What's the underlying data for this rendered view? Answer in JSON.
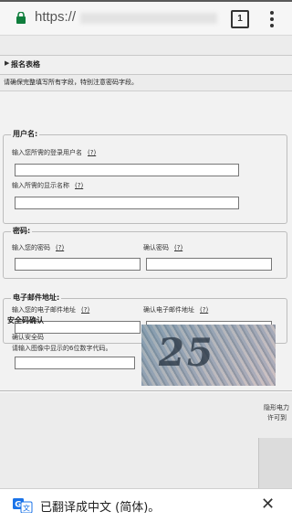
{
  "browser": {
    "url_prefix": "https://",
    "tab_count": "1"
  },
  "form": {
    "section_title": "报名表格",
    "instruction": "请确保完整填写所有字段，特别注意密码字段。",
    "help_mark": "(?)",
    "username": {
      "legend": "用户名:",
      "login_label": "输入您所需的登录用户名",
      "display_label": "输入所需的显示名称"
    },
    "password": {
      "legend": "密码:",
      "enter_label": "输入您的密码",
      "confirm_label": "确认密码"
    },
    "email": {
      "legend": "电子邮件地址:",
      "enter_label": "输入您的电子邮件地址",
      "confirm_label": "确认电子邮件地址"
    },
    "captcha": {
      "legend": "安全码确认",
      "label_line1": "确认安全码",
      "label_line2": "请输入图像中显示的6位数字代码。",
      "image_text": "25"
    }
  },
  "footer": {
    "line1": "隐形电力",
    "line2": "许可到"
  },
  "translate_bar": {
    "message": "已翻译成中文 (简体)。",
    "close_icon": "close-icon"
  }
}
